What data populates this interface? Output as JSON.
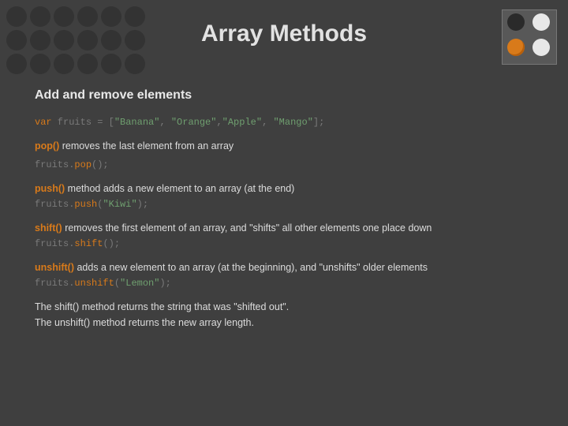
{
  "title": "Array Methods",
  "subtitle": "Add and remove elements",
  "line_var": {
    "kw": "var",
    "rest": " fruits = [",
    "s1": "\"Banana\"",
    "c1": ", ",
    "s2": "\"Orange\"",
    "c2": ",",
    "s3": "\"Apple\"",
    "c3": ", ",
    "s4": "\"Mango\"",
    "end": "];"
  },
  "pop": {
    "kw": "pop()",
    "desc": " removes the last element from an array",
    "code_pre": "fruits.",
    "code_kw": "pop",
    "code_post": "();"
  },
  "push": {
    "kw": "push()",
    "desc": " method adds a new element to an array (at the end)",
    "code_pre": "fruits.",
    "code_kw": "push",
    "code_paren1": "(",
    "code_arg": "\"Kiwi\"",
    "code_paren2": ");"
  },
  "shift": {
    "kw": "shift()",
    "desc": " removes the first element of an array, and \"shifts\" all other elements one place down",
    "code_pre": "fruits.",
    "code_kw": "shift",
    "code_post": "();"
  },
  "unshift": {
    "kw": "unshift()",
    "desc": " adds a new element to an array (at the beginning), and \"unshifts\" older elements",
    "code_pre": "fruits.",
    "code_kw": "unshift",
    "code_paren1": "(",
    "code_arg": "\"Lemon\"",
    "code_paren2": ");"
  },
  "note1": "The shift() method returns the string that was \"shifted out\".",
  "note2": "The unshift() method returns the new array length."
}
